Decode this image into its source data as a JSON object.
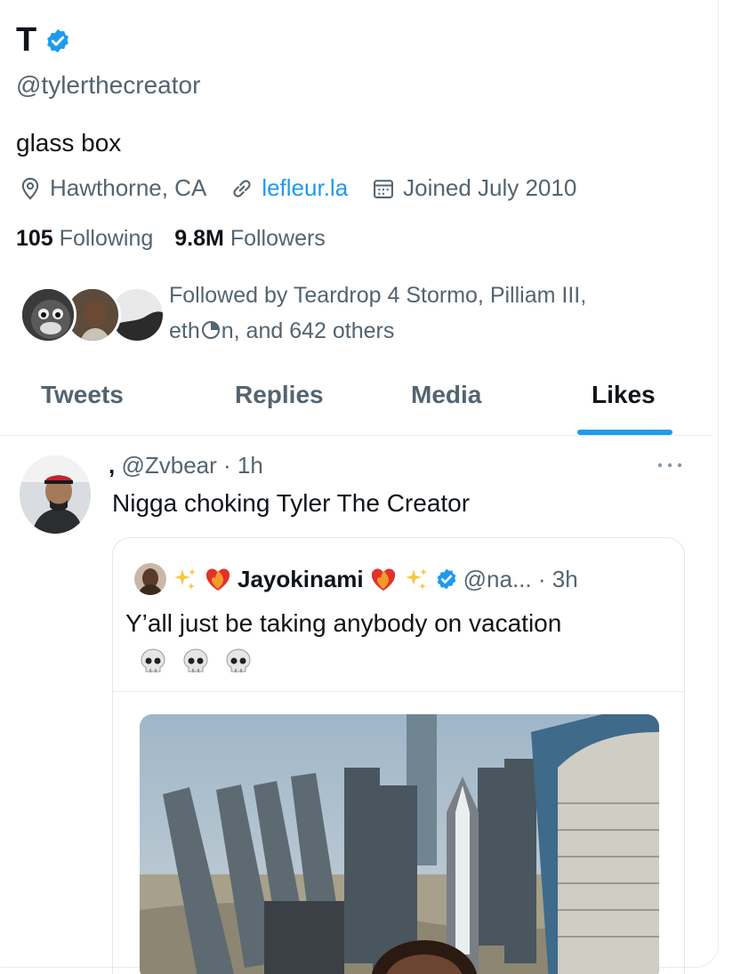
{
  "profile": {
    "display_name": "T",
    "handle": "@tylerthecreator",
    "bio": "glass box",
    "location": "Hawthorne, CA",
    "website": "lefleur.la",
    "joined": "Joined July 2010",
    "following_count": "105",
    "following_label": "Following",
    "followers_count": "9.8M",
    "followers_label": "Followers",
    "followed_by_line1": "Followed by Teardrop 4 Stormo, Pilliam III,",
    "followed_by_line2_pre": "eth",
    "followed_by_line2_post": "n, and 642 others"
  },
  "tabs": [
    "Tweets",
    "Replies",
    "Media",
    "Likes"
  ],
  "active_tab": "Likes",
  "tweet": {
    "name": ",",
    "handle_time": "@Zvbear · 1h",
    "text": "Nigga choking Tyler The Creator",
    "quote": {
      "name": "Jayokinami",
      "handle_time": "@na... · 3h",
      "text": "Y’all just be taking anybody on vacation",
      "emojis": "💀💀💀"
    }
  },
  "icons": {
    "verified": "verified-badge-icon",
    "location": "location-pin-icon",
    "link": "link-icon",
    "calendar": "calendar-icon",
    "more": "more-dots-icon",
    "sparkle": "sparkles-icon",
    "heart": "heart-on-fire-icon",
    "skull": "skull-icon"
  },
  "colors": {
    "accent": "#1d9bf0",
    "text_primary": "#0f1419",
    "text_secondary": "#536471",
    "border": "#e8ecef"
  }
}
